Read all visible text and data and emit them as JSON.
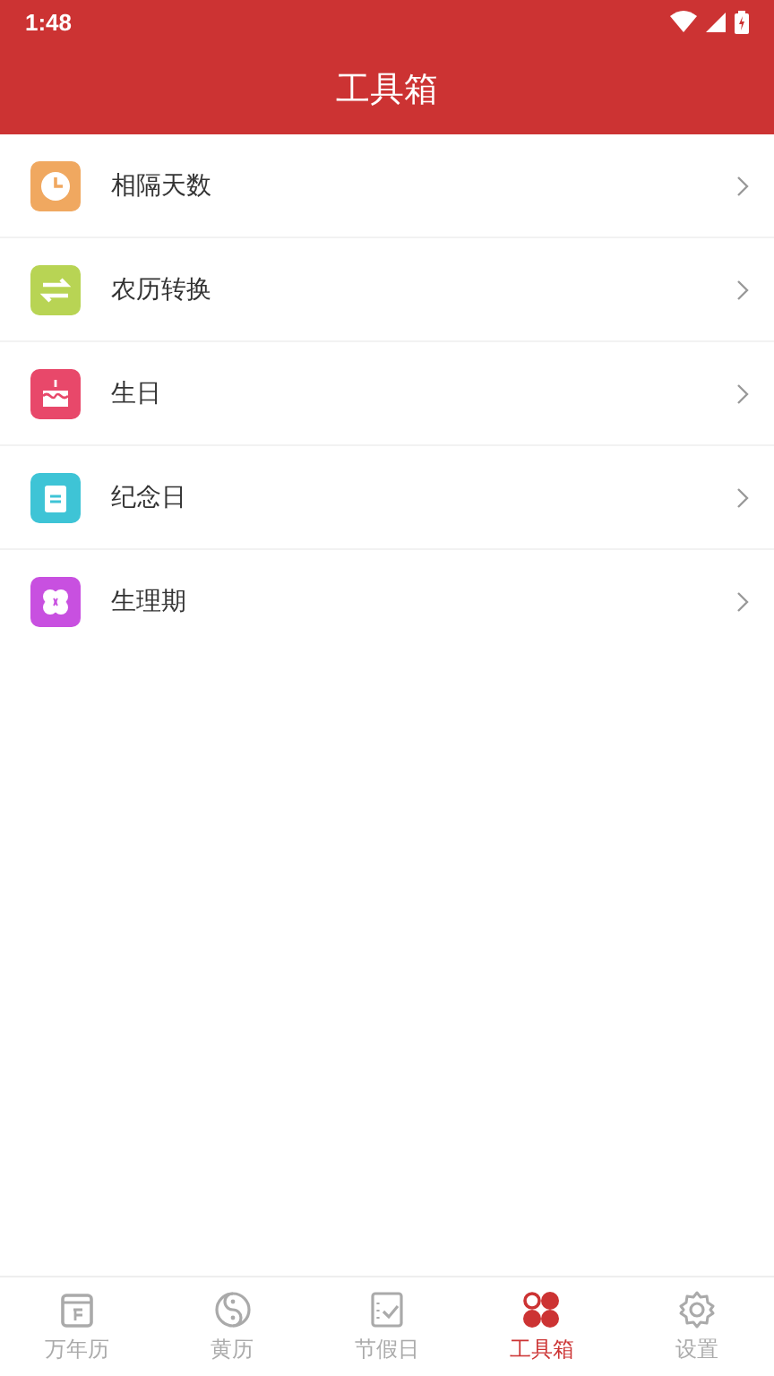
{
  "status_bar": {
    "time": "1:48"
  },
  "header": {
    "title": "工具箱"
  },
  "tools": [
    {
      "label": "相隔天数",
      "kind": "clock",
      "color": "#f0a860"
    },
    {
      "label": "农历转换",
      "kind": "swap",
      "color": "#b8d454"
    },
    {
      "label": "生日",
      "kind": "cake",
      "color": "#e8486a"
    },
    {
      "label": "纪念日",
      "kind": "note",
      "color": "#3ec4d6"
    },
    {
      "label": "生理期",
      "kind": "flower",
      "color": "#c850e0"
    }
  ],
  "tabs": [
    {
      "label": "万年历",
      "kind": "calendar",
      "selected": false
    },
    {
      "label": "黄历",
      "kind": "yinyang",
      "selected": false
    },
    {
      "label": "节假日",
      "kind": "check",
      "selected": false
    },
    {
      "label": "工具箱",
      "kind": "dots",
      "selected": true
    },
    {
      "label": "设置",
      "kind": "gear",
      "selected": false
    }
  ]
}
